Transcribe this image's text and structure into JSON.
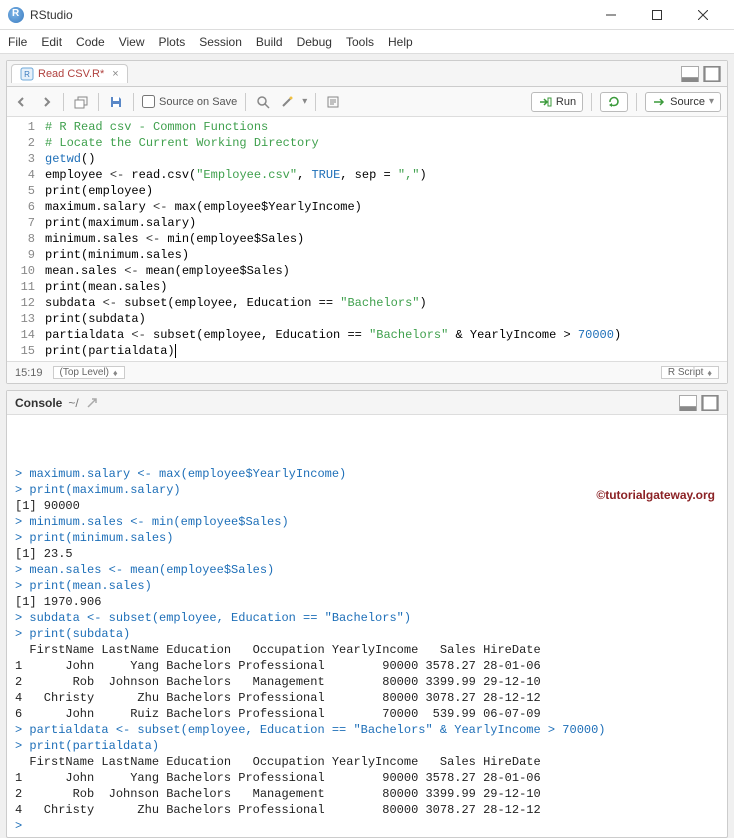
{
  "window": {
    "title": "RStudio"
  },
  "menubar": [
    "File",
    "Edit",
    "Code",
    "View",
    "Plots",
    "Session",
    "Build",
    "Debug",
    "Tools",
    "Help"
  ],
  "tab": {
    "filename": "Read CSV.R*"
  },
  "toolbar": {
    "source_on_save": "Source on Save",
    "run": "Run",
    "source": "Source"
  },
  "status": {
    "position": "15:19",
    "scope": "(Top Level)",
    "lang": "R Script"
  },
  "code": {
    "lines": [
      {
        "n": 1,
        "spans": [
          {
            "t": "# R Read csv - Common Functions",
            "c": "c-comment"
          }
        ]
      },
      {
        "n": 2,
        "spans": [
          {
            "t": "# Locate the Current Working Directory",
            "c": "c-comment"
          }
        ]
      },
      {
        "n": 3,
        "spans": [
          {
            "t": "getwd",
            "c": "c-func"
          },
          {
            "t": "()",
            "c": ""
          }
        ]
      },
      {
        "n": 4,
        "spans": [
          {
            "t": "employee ",
            "c": ""
          },
          {
            "t": "<-",
            "c": "c-op"
          },
          {
            "t": " read.csv(",
            "c": ""
          },
          {
            "t": "\"Employee.csv\"",
            "c": "c-string"
          },
          {
            "t": ", ",
            "c": ""
          },
          {
            "t": "TRUE",
            "c": "c-num"
          },
          {
            "t": ", sep = ",
            "c": ""
          },
          {
            "t": "\",\"",
            "c": "c-string"
          },
          {
            "t": ")",
            "c": ""
          }
        ]
      },
      {
        "n": 5,
        "spans": [
          {
            "t": "print(employee)",
            "c": ""
          }
        ]
      },
      {
        "n": 6,
        "spans": [
          {
            "t": "maximum.salary ",
            "c": ""
          },
          {
            "t": "<-",
            "c": "c-op"
          },
          {
            "t": " max(employee$YearlyIncome)",
            "c": ""
          }
        ]
      },
      {
        "n": 7,
        "spans": [
          {
            "t": "print(maximum.salary)",
            "c": ""
          }
        ]
      },
      {
        "n": 8,
        "spans": [
          {
            "t": "minimum.sales ",
            "c": ""
          },
          {
            "t": "<-",
            "c": "c-op"
          },
          {
            "t": " min(employee$Sales)",
            "c": ""
          }
        ]
      },
      {
        "n": 9,
        "spans": [
          {
            "t": "print(minimum.sales)",
            "c": ""
          }
        ]
      },
      {
        "n": 10,
        "spans": [
          {
            "t": "mean.sales ",
            "c": ""
          },
          {
            "t": "<-",
            "c": "c-op"
          },
          {
            "t": " mean(employee$Sales)",
            "c": ""
          }
        ]
      },
      {
        "n": 11,
        "spans": [
          {
            "t": "print(mean.sales)",
            "c": ""
          }
        ]
      },
      {
        "n": 12,
        "spans": [
          {
            "t": "subdata ",
            "c": ""
          },
          {
            "t": "<-",
            "c": "c-op"
          },
          {
            "t": " subset(employee, Education == ",
            "c": ""
          },
          {
            "t": "\"Bachelors\"",
            "c": "c-string"
          },
          {
            "t": ")",
            "c": ""
          }
        ]
      },
      {
        "n": 13,
        "spans": [
          {
            "t": "print(subdata)",
            "c": ""
          }
        ]
      },
      {
        "n": 14,
        "spans": [
          {
            "t": "partialdata ",
            "c": ""
          },
          {
            "t": "<-",
            "c": "c-op"
          },
          {
            "t": " subset(employee, Education == ",
            "c": ""
          },
          {
            "t": "\"Bachelors\"",
            "c": "c-string"
          },
          {
            "t": " & YearlyIncome > ",
            "c": ""
          },
          {
            "t": "70000",
            "c": "c-num"
          },
          {
            "t": ")",
            "c": ""
          }
        ]
      },
      {
        "n": 15,
        "spans": [
          {
            "t": "print(partialdata)",
            "c": ""
          }
        ],
        "cursor": true
      }
    ]
  },
  "console": {
    "title": "Console",
    "path": "~/",
    "watermark": "©tutorialgateway.org",
    "lines": [
      {
        "c": "con-prompt",
        "t": "> maximum.salary <- max(employee$YearlyIncome)"
      },
      {
        "c": "con-prompt",
        "t": "> print(maximum.salary)"
      },
      {
        "c": "con-out",
        "t": "[1] 90000"
      },
      {
        "c": "con-prompt",
        "t": "> minimum.sales <- min(employee$Sales)"
      },
      {
        "c": "con-prompt",
        "t": "> print(minimum.sales)"
      },
      {
        "c": "con-out",
        "t": "[1] 23.5"
      },
      {
        "c": "con-prompt",
        "t": "> mean.sales <- mean(employee$Sales)"
      },
      {
        "c": "con-prompt",
        "t": "> print(mean.sales)"
      },
      {
        "c": "con-out",
        "t": "[1] 1970.906"
      },
      {
        "c": "con-prompt",
        "t": "> subdata <- subset(employee, Education == \"Bachelors\")"
      },
      {
        "c": "con-prompt",
        "t": "> print(subdata)"
      },
      {
        "c": "con-out",
        "t": "  FirstName LastName Education   Occupation YearlyIncome   Sales HireDate"
      },
      {
        "c": "con-out",
        "t": "1      John     Yang Bachelors Professional        90000 3578.27 28-01-06"
      },
      {
        "c": "con-out",
        "t": "2       Rob  Johnson Bachelors   Management        80000 3399.99 29-12-10"
      },
      {
        "c": "con-out",
        "t": "4   Christy      Zhu Bachelors Professional        80000 3078.27 28-12-12"
      },
      {
        "c": "con-out",
        "t": "6      John     Ruiz Bachelors Professional        70000  539.99 06-07-09"
      },
      {
        "c": "con-prompt",
        "t": "> partialdata <- subset(employee, Education == \"Bachelors\" & YearlyIncome > 70000)"
      },
      {
        "c": "con-prompt",
        "t": "> print(partialdata)"
      },
      {
        "c": "con-out",
        "t": "  FirstName LastName Education   Occupation YearlyIncome   Sales HireDate"
      },
      {
        "c": "con-out",
        "t": "1      John     Yang Bachelors Professional        90000 3578.27 28-01-06"
      },
      {
        "c": "con-out",
        "t": "2       Rob  Johnson Bachelors   Management        80000 3399.99 29-12-10"
      },
      {
        "c": "con-out",
        "t": "4   Christy      Zhu Bachelors Professional        80000 3078.27 28-12-12"
      },
      {
        "c": "con-prompt",
        "t": "> "
      }
    ]
  }
}
